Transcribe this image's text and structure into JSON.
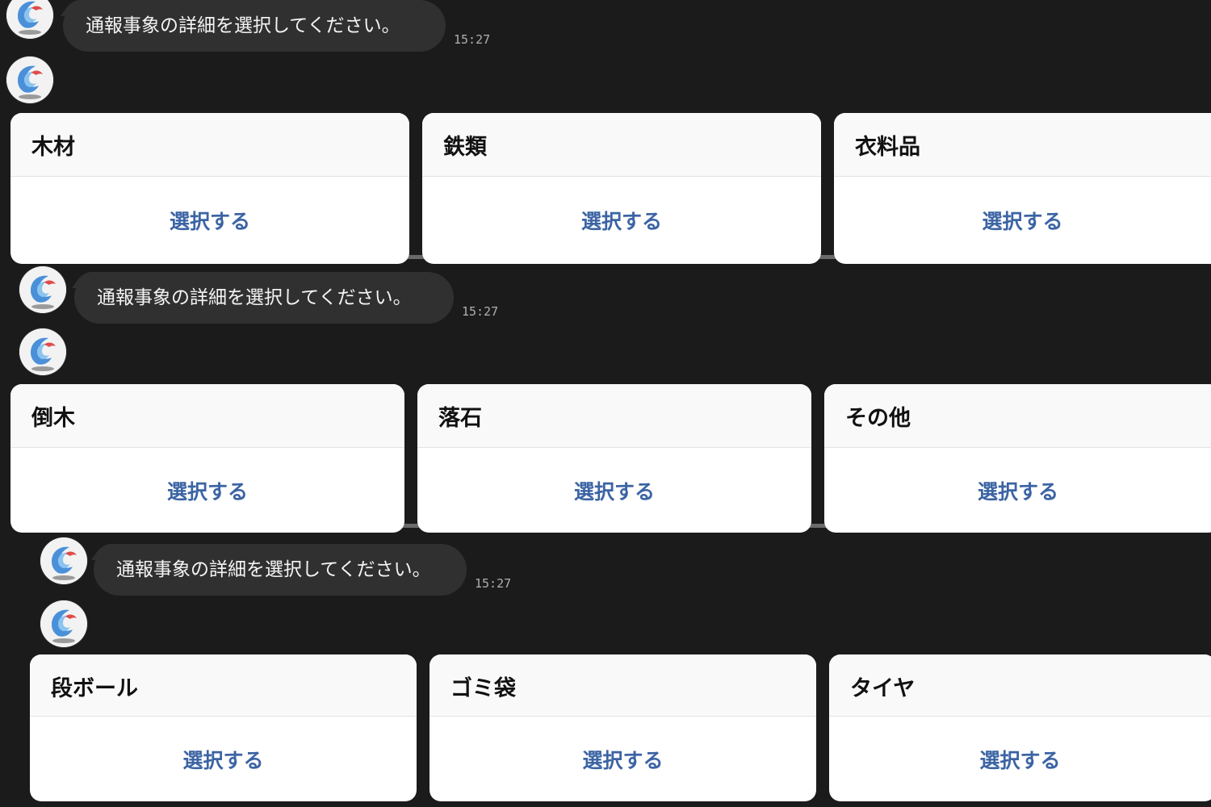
{
  "sections": [
    {
      "message": "通報事象の詳細を選択してください。",
      "time": "15:27",
      "cards": [
        {
          "title": "木材",
          "button": "選択する"
        },
        {
          "title": "鉄類",
          "button": "選択する"
        },
        {
          "title": "衣料品",
          "button": "選択する"
        }
      ]
    },
    {
      "message": "通報事象の詳細を選択してください。",
      "time": "15:27",
      "cards": [
        {
          "title": "倒木",
          "button": "選択する"
        },
        {
          "title": "落石",
          "button": "選択する"
        },
        {
          "title": "その他",
          "button": "選択する"
        }
      ]
    },
    {
      "message": "通報事象の詳細を選択してください。",
      "time": "15:27",
      "cards": [
        {
          "title": "段ボール",
          "button": "選択する"
        },
        {
          "title": "ゴミ袋",
          "button": "選択する"
        },
        {
          "title": "タイヤ",
          "button": "選択する"
        }
      ]
    }
  ],
  "icons": {
    "avatar": "bot-logo-icon"
  },
  "colors": {
    "background": "#1b1b1b",
    "bubble": "#303030",
    "button_text": "#3c64a4",
    "logo_blue": "#4a90d9",
    "logo_red": "#e04a4a"
  }
}
